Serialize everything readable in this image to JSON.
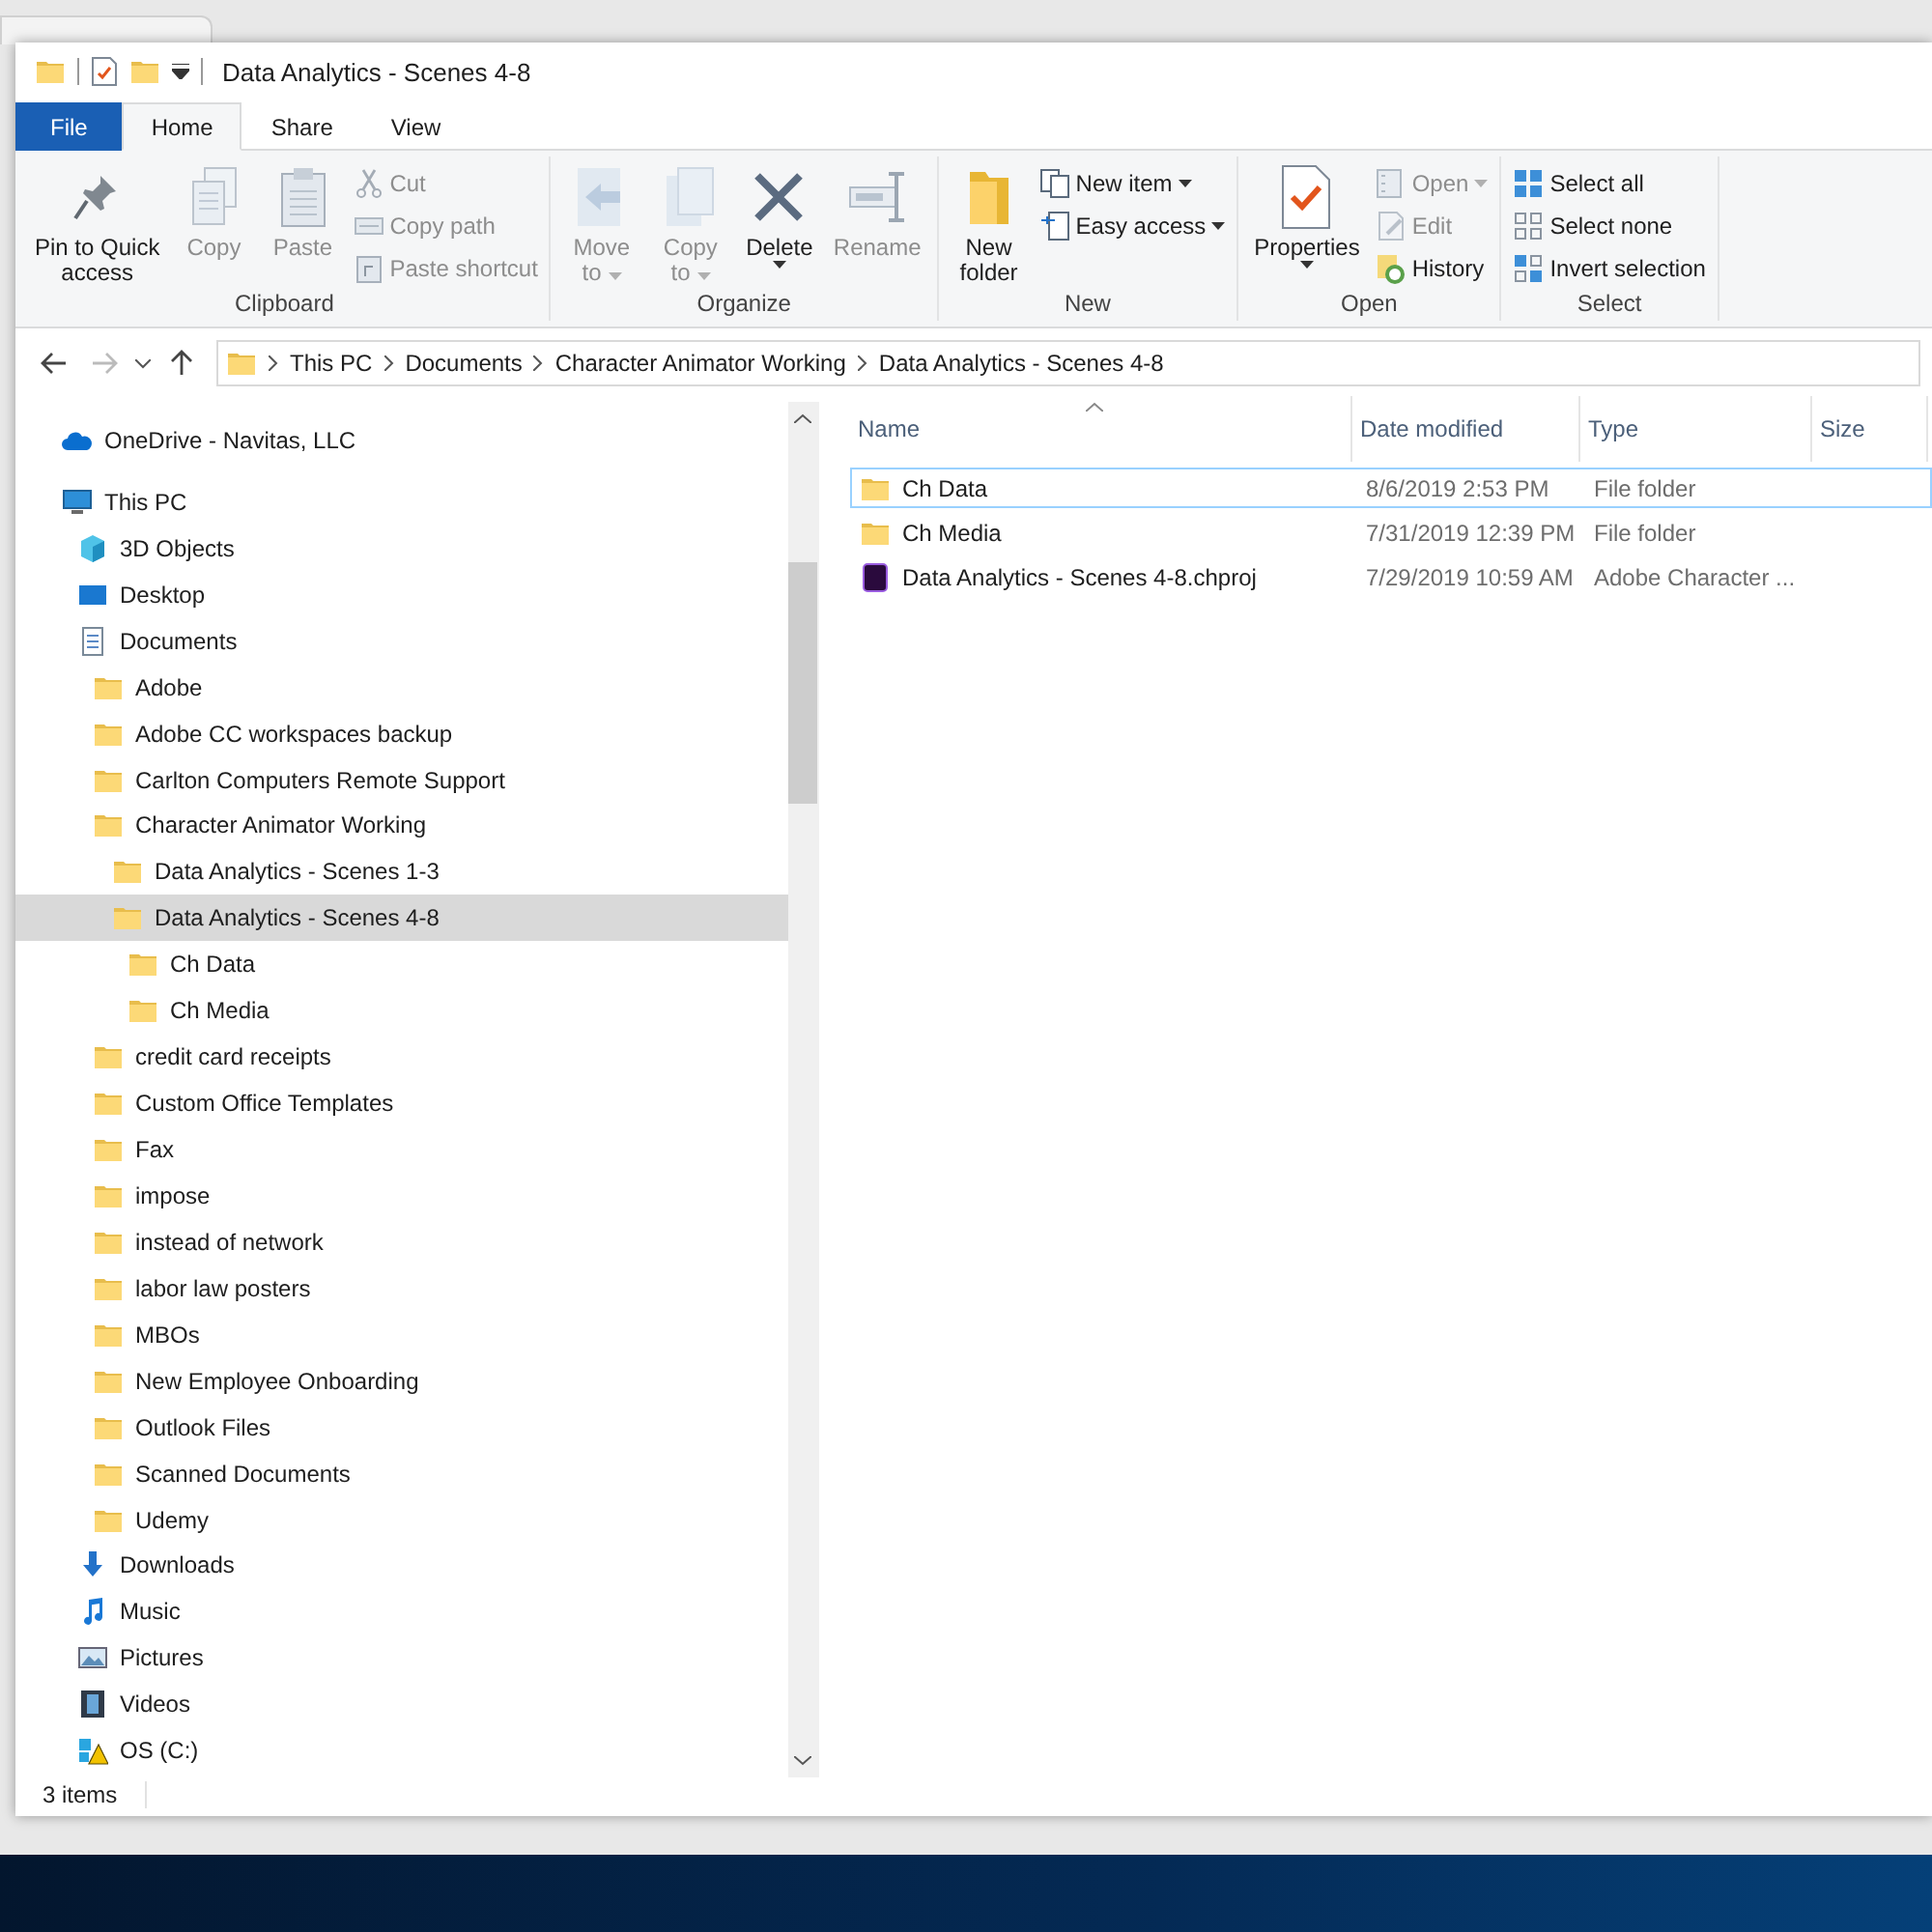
{
  "window": {
    "title": "Data Analytics - Scenes 4-8"
  },
  "ribbon_tabs": [
    {
      "label": "File",
      "kind": "file",
      "selected": false
    },
    {
      "label": "Home",
      "kind": "tab",
      "selected": true
    },
    {
      "label": "Share",
      "kind": "tab",
      "selected": false
    },
    {
      "label": "View",
      "kind": "tab",
      "selected": false
    }
  ],
  "ribbon_groups": [
    {
      "label": "Clipboard",
      "items": [
        {
          "kind": "large",
          "label": "Pin to Quick\naccess",
          "disabled": false,
          "dropdown": false
        },
        {
          "kind": "large",
          "label": "Copy",
          "disabled": true,
          "dropdown": false
        },
        {
          "kind": "large",
          "label": "Paste",
          "disabled": true,
          "dropdown": false
        },
        {
          "kind": "small",
          "label": "Cut",
          "disabled": true,
          "dropdown": false
        },
        {
          "kind": "small",
          "label": "Copy path",
          "disabled": true,
          "dropdown": false
        },
        {
          "kind": "small",
          "label": "Paste shortcut",
          "disabled": true,
          "dropdown": false
        }
      ]
    },
    {
      "label": "Organize",
      "items": [
        {
          "kind": "large",
          "label": "Move\nto",
          "disabled": true,
          "dropdown": true
        },
        {
          "kind": "large",
          "label": "Copy\nto",
          "disabled": true,
          "dropdown": true
        },
        {
          "kind": "large",
          "label": "Delete",
          "disabled": false,
          "dropdown": true
        },
        {
          "kind": "large",
          "label": "Rename",
          "disabled": true,
          "dropdown": false
        }
      ]
    },
    {
      "label": "New",
      "items": [
        {
          "kind": "large",
          "label": "New\nfolder",
          "disabled": false,
          "dropdown": false
        },
        {
          "kind": "small",
          "label": "New item",
          "disabled": false,
          "dropdown": true
        },
        {
          "kind": "small",
          "label": "Easy access",
          "disabled": false,
          "dropdown": true
        }
      ]
    },
    {
      "label": "Open",
      "items": [
        {
          "kind": "large",
          "label": "Properties",
          "disabled": false,
          "dropdown": true
        },
        {
          "kind": "small",
          "label": "Open",
          "disabled": true,
          "dropdown": true
        },
        {
          "kind": "small",
          "label": "Edit",
          "disabled": true,
          "dropdown": false
        },
        {
          "kind": "small",
          "label": "History",
          "disabled": false,
          "dropdown": false
        }
      ]
    },
    {
      "label": "Select",
      "items": [
        {
          "kind": "small",
          "label": "Select all",
          "disabled": false,
          "dropdown": false
        },
        {
          "kind": "small",
          "label": "Select none",
          "disabled": false,
          "dropdown": false
        },
        {
          "kind": "small",
          "label": "Invert selection",
          "disabled": false,
          "dropdown": false
        }
      ]
    }
  ],
  "address_bar": {
    "crumbs": [
      "This PC",
      "Documents",
      "Character Animator Working",
      "Data Analytics - Scenes 4-8"
    ]
  },
  "navigation_pane": {
    "items": [
      {
        "label": "OneDrive - Navitas, LLC",
        "kind": "cloud",
        "selected": false
      },
      {
        "label": "This PC",
        "kind": "pc",
        "selected": false,
        "children": [
          {
            "label": "3D Objects",
            "kind": "cube",
            "selected": false
          },
          {
            "label": "Desktop",
            "kind": "desktop",
            "selected": false
          },
          {
            "label": "Documents",
            "kind": "documents",
            "selected": false,
            "children": [
              {
                "label": "Adobe",
                "kind": "folder",
                "selected": false
              },
              {
                "label": "Adobe CC workspaces backup",
                "kind": "folder",
                "selected": false
              },
              {
                "label": "Carlton Computers Remote Support",
                "kind": "folder",
                "selected": false
              },
              {
                "label": "Character Animator Working",
                "kind": "folder",
                "selected": false,
                "children": [
                  {
                    "label": "Data Analytics - Scenes 1-3",
                    "kind": "folder",
                    "selected": false
                  },
                  {
                    "label": "Data Analytics - Scenes 4-8",
                    "kind": "folder",
                    "selected": true,
                    "children": [
                      {
                        "label": "Ch Data",
                        "kind": "folder",
                        "selected": false
                      },
                      {
                        "label": "Ch Media",
                        "kind": "folder",
                        "selected": false
                      }
                    ]
                  }
                ]
              },
              {
                "label": "credit card receipts",
                "kind": "folder",
                "selected": false
              },
              {
                "label": "Custom Office Templates",
                "kind": "folder",
                "selected": false
              },
              {
                "label": "Fax",
                "kind": "folder",
                "selected": false
              },
              {
                "label": "impose",
                "kind": "folder",
                "selected": false
              },
              {
                "label": "instead of network",
                "kind": "folder",
                "selected": false
              },
              {
                "label": "labor law posters",
                "kind": "folder",
                "selected": false
              },
              {
                "label": "MBOs",
                "kind": "folder",
                "selected": false
              },
              {
                "label": "New Employee Onboarding",
                "kind": "folder",
                "selected": false
              },
              {
                "label": "Outlook Files",
                "kind": "folder",
                "selected": false
              },
              {
                "label": "Scanned Documents",
                "kind": "folder",
                "selected": false
              },
              {
                "label": "Udemy",
                "kind": "folder",
                "selected": false
              }
            ]
          },
          {
            "label": "Downloads",
            "kind": "downloads",
            "selected": false
          },
          {
            "label": "Music",
            "kind": "music",
            "selected": false
          },
          {
            "label": "Pictures",
            "kind": "pictures",
            "selected": false
          },
          {
            "label": "Videos",
            "kind": "videos",
            "selected": false
          },
          {
            "label": "OS (C:)",
            "kind": "drive",
            "selected": false
          }
        ]
      }
    ]
  },
  "file_list": {
    "columns": [
      "Name",
      "Date modified",
      "Type",
      "Size"
    ],
    "rows": [
      {
        "name": "Ch Data",
        "kind": "folder",
        "date_modified": "8/6/2019 2:53 PM",
        "type": "File folder",
        "selected": true
      },
      {
        "name": "Ch Media",
        "kind": "folder",
        "date_modified": "7/31/2019 12:39 PM",
        "type": "File folder",
        "selected": false
      },
      {
        "name": "Data Analytics - Scenes 4-8.chproj",
        "kind": "project",
        "date_modified": "7/29/2019 10:59 AM",
        "type": "Adobe Character ...",
        "selected": false
      }
    ]
  },
  "status_bar": {
    "item_count": "3 items"
  }
}
